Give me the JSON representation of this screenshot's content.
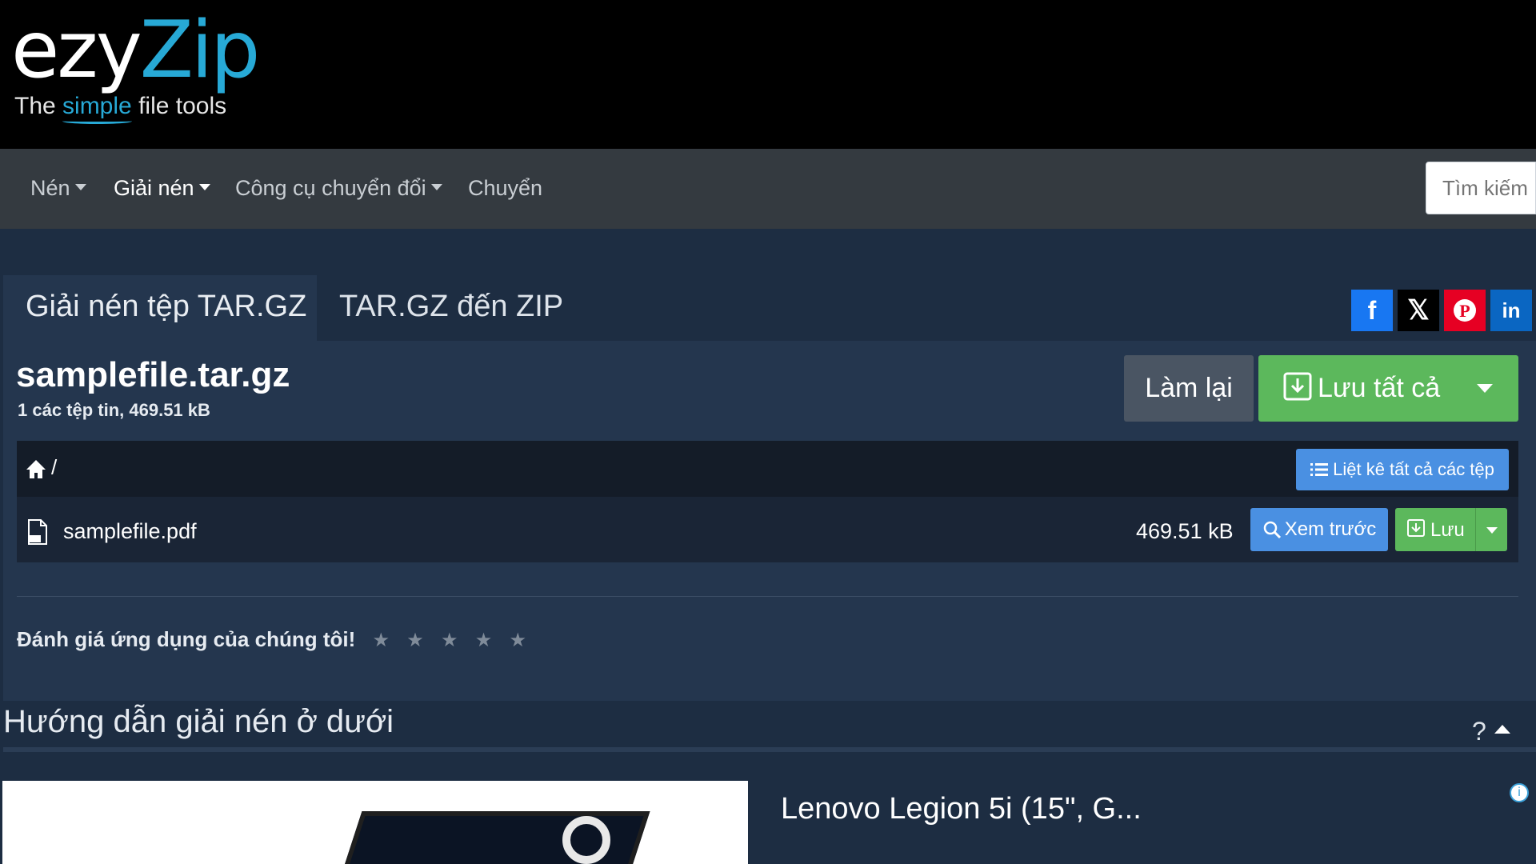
{
  "logo": {
    "text_main": "ezy",
    "text_accent": "Zip",
    "tagline_pre": "The ",
    "tagline_accent": "simple",
    "tagline_post": " file tools"
  },
  "nav": {
    "items": [
      {
        "label": "Nén",
        "has_caret": true
      },
      {
        "label": "Giải nén",
        "has_caret": true
      },
      {
        "label": "Công cụ chuyển đổi",
        "has_caret": true
      },
      {
        "label": "Chuyển",
        "has_caret": false
      }
    ],
    "search_placeholder": "Tìm kiếm"
  },
  "tabs": [
    {
      "label": "Giải nén tệp TAR.GZ",
      "active": true
    },
    {
      "label": "TAR.GZ đến ZIP",
      "active": false
    }
  ],
  "social": {
    "facebook": "f",
    "x": "𝕏",
    "pinterest": "P",
    "linkedin": "in"
  },
  "archive": {
    "filename": "samplefile.tar.gz",
    "info": "1 các tệp tin, 469.51 kB",
    "reset_label": "Làm lại",
    "save_all_label": "Lưu tất cả"
  },
  "browser": {
    "path": "/",
    "list_all_label": "Liệt kê tất cả các tệp",
    "files": [
      {
        "name": "samplefile.pdf",
        "size": "469.51 kB",
        "preview_label": "Xem trước",
        "save_label": "Lưu"
      }
    ]
  },
  "rating": {
    "label": "Đánh giá ứng dụng của chúng tôi!",
    "stars": [
      "★",
      "★",
      "★",
      "★",
      "★"
    ],
    "value": 0
  },
  "guide": {
    "title": "Hướng dẫn giải nén ở dưới",
    "help": "?"
  },
  "ad": {
    "title": "Lenovo Legion 5i (15\", G...",
    "info": "i"
  },
  "colors": {
    "accent": "#27a9d6",
    "primary_blue": "#4a90e2",
    "success_green": "#5cb85c",
    "panel": "#24364e",
    "background": "#1d2d42"
  }
}
